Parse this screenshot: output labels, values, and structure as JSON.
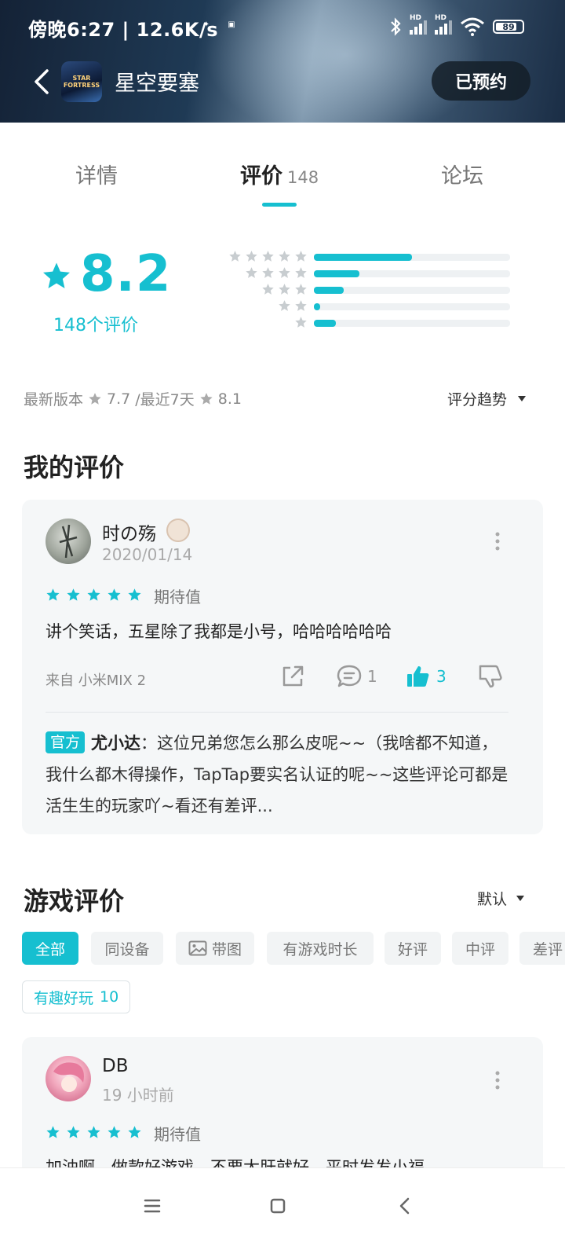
{
  "status_bar": {
    "time_speed": "傍晚6:27 | 12.6K/s",
    "battery": "89",
    "network_label": "HD"
  },
  "app_bar": {
    "title": "星空要塞",
    "app_icon_text": "STAR FORTRESS",
    "reserve_button": "已预约"
  },
  "tabs": [
    {
      "label": "详情"
    },
    {
      "label": "评价",
      "count": "148"
    },
    {
      "label": "论坛"
    }
  ],
  "rating": {
    "score": "8.2",
    "count_label": "148个评价",
    "distribution": [
      {
        "stars": 5,
        "fraction": 0.5
      },
      {
        "stars": 4,
        "fraction": 0.23
      },
      {
        "stars": 3,
        "fraction": 0.15
      },
      {
        "stars": 2,
        "fraction": 0.03
      },
      {
        "stars": 1,
        "fraction": 0.11
      }
    ],
    "latest_version_label": "最新版本",
    "latest_version_score": "7.7",
    "recent_label": "/最近7天",
    "recent_score": "8.1",
    "trend_button": "评分趋势",
    "accent_color": "#16bfd0"
  },
  "my_review": {
    "section_title": "我的评价",
    "user": "时の殇",
    "date": "2020/01/14",
    "stars": 5,
    "expect_label": "期待值",
    "text": "讲个笑话，五星除了我都是小号，哈哈哈哈哈哈",
    "device": "来自 小米MIX 2",
    "comments": "1",
    "likes": "3",
    "official_tag": "官方",
    "reply_name": "尤小达",
    "reply_text": "：这位兄弟您怎么那么皮呢~~（我啥都不知道，我什么都木得操作，TapTap要实名认证的呢~~这些评论可都是活生生的玩家吖~看还有差评..."
  },
  "game_reviews": {
    "section_title": "游戏评价",
    "sort_label": "默认",
    "filters": [
      "全部",
      "同设备",
      "带图",
      "有游戏时长",
      "好评",
      "中评",
      "差评"
    ],
    "tag_chip_label": "有趣好玩",
    "tag_chip_count": "10",
    "first_review": {
      "user": "DB",
      "time": "19 小时前",
      "stars": 5,
      "expect_label": "期待值",
      "text": "加油啊，做款好游戏，不要太肝就好，平时发发小福"
    }
  }
}
